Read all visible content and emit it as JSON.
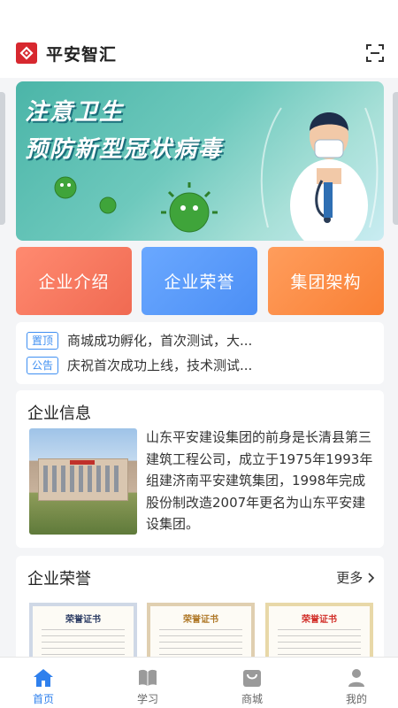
{
  "app": {
    "title": "平安智汇"
  },
  "banner": {
    "line1": "注意卫生",
    "line2": "预防新型冠状病毒"
  },
  "quick_actions": [
    {
      "label": "企业介绍"
    },
    {
      "label": "企业荣誉"
    },
    {
      "label": "集团架构"
    }
  ],
  "notices": [
    {
      "tag": "置顶",
      "text": "商城成功孵化，首次测试，大..."
    },
    {
      "tag": "公告",
      "text": "庆祝首次成功上线，技术测试..."
    }
  ],
  "company_info": {
    "title": "企业信息",
    "text": "山东平安建设集团的前身是长清县第三建筑工程公司，成立于1975年1993年组建济南平安建筑集团，1998年完成股份制改造2007年更名为山东平安建设集团。"
  },
  "honors": {
    "title": "企业荣誉",
    "more": "更多",
    "certificates": [
      {
        "title": "荣誉证书"
      },
      {
        "title": "荣誉证书"
      },
      {
        "title": "荣誉证书"
      }
    ]
  },
  "tabbar": [
    {
      "label": "首页",
      "icon": "home-icon",
      "active": true
    },
    {
      "label": "学习",
      "icon": "book-icon",
      "active": false
    },
    {
      "label": "商城",
      "icon": "shopping-bag-icon",
      "active": false
    },
    {
      "label": "我的",
      "icon": "user-icon",
      "active": false
    }
  ],
  "colors": {
    "accent": "#2f80ed",
    "brand": "#d7282f"
  }
}
